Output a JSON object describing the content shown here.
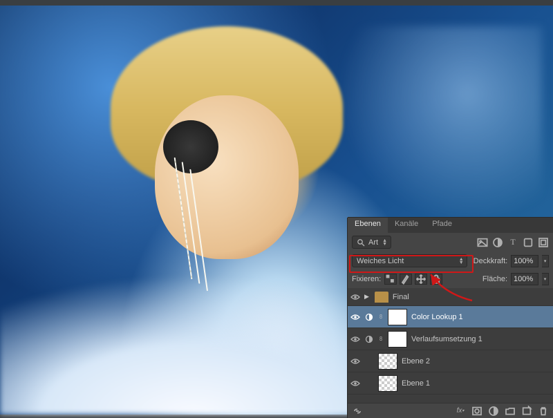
{
  "panel": {
    "tabs": {
      "layers": "Ebenen",
      "channels": "Kanäle",
      "paths": "Pfade"
    },
    "filter": {
      "label": "Art",
      "search_icon": "search-icon"
    },
    "blend_mode": {
      "value": "Weiches Licht"
    },
    "opacity": {
      "label": "Deckkraft:",
      "value": "100%"
    },
    "lock": {
      "label": "Fixieren:"
    },
    "fill": {
      "label": "Fläche:",
      "value": "100%"
    },
    "layers": [
      {
        "type": "group",
        "name": "Final",
        "visible": true
      },
      {
        "type": "adjustment",
        "name": "Color Lookup 1",
        "visible": true,
        "masked": true,
        "selected": true
      },
      {
        "type": "adjustment",
        "name": "Verlaufsumsetzung 1",
        "visible": true,
        "masked": true
      },
      {
        "type": "pixel",
        "name": "Ebene 2",
        "visible": true,
        "transparent": true
      },
      {
        "type": "pixel",
        "name": "Ebene 1",
        "visible": true,
        "transparent": true
      }
    ]
  }
}
